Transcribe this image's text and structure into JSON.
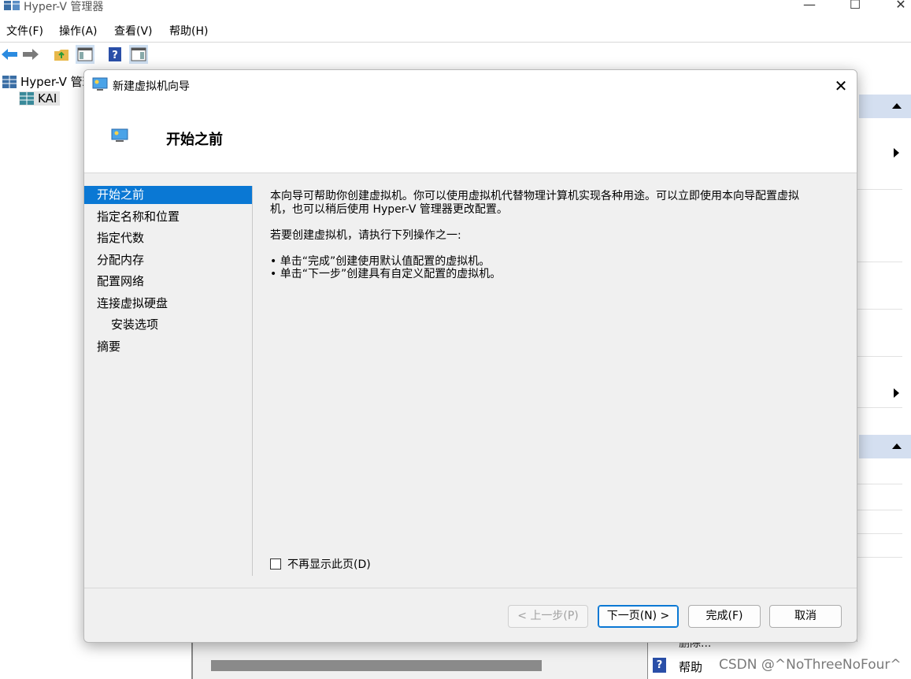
{
  "app": {
    "title": "Hyper-V 管理器",
    "minimize": "—",
    "maximize": "☐",
    "close": "✕"
  },
  "menu": [
    "文件(F)",
    "操作(A)",
    "查看(V)",
    "帮助(H)"
  ],
  "toolbar": {
    "icons": [
      "back-arrow-icon",
      "forward-arrow-icon",
      "folder-up-icon",
      "console-tree-icon",
      "help-icon",
      "action-pane-icon"
    ]
  },
  "tree": {
    "root": "Hyper-V 管理",
    "child": "KAI"
  },
  "dialog": {
    "title": "新建虚拟机向导",
    "close": "✕",
    "header_title": "开始之前",
    "nav": [
      {
        "label": "开始之前",
        "selected": true
      },
      {
        "label": "指定名称和位置"
      },
      {
        "label": "指定代数"
      },
      {
        "label": "分配内存"
      },
      {
        "label": "配置网络"
      },
      {
        "label": "连接虚拟硬盘"
      },
      {
        "label": "安装选项"
      },
      {
        "label": "摘要"
      }
    ],
    "content": {
      "p1_line1": "本向导可帮助你创建虚拟机。你可以使用虚拟机代替物理计算机实现各种用途。可以立即使用本向导配置虚拟",
      "p1_line2": "机，也可以稍后使用 Hyper-V 管理器更改配置。",
      "p2": "若要创建虚拟机，请执行下列操作之一:",
      "bullet1": "• 单击“完成”创建使用默认值配置的虚拟机。",
      "bullet2": "• 单击“下一步”创建具有自定义配置的虚拟机。"
    },
    "checkbox_label": "不再显示此页(D)",
    "buttons": {
      "prev": "< 上一步(P)",
      "next": "下一页(N) >",
      "finish": "完成(F)",
      "cancel": "取消"
    }
  },
  "actions": {
    "delete_label": "删除...",
    "help_label": "帮助",
    "help_icon_glyph": "?"
  },
  "watermark": "CSDN @^NoThreeNoFour^",
  "colors": {
    "selection": "#0a78d4",
    "action_header": "#d4dff0"
  }
}
